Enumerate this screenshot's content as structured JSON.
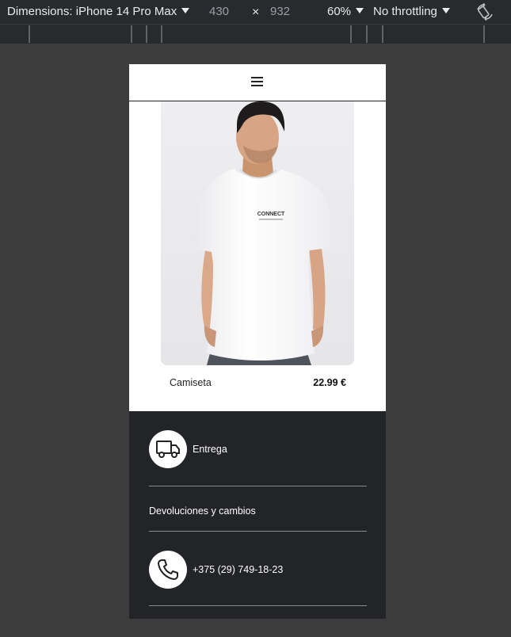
{
  "devtools": {
    "device_label": "Dimensions: iPhone 14 Pro Max",
    "width": "430",
    "times": "×",
    "height": "932",
    "zoom": "60%",
    "throttling": "No throttling"
  },
  "product": {
    "name": "Camiseta",
    "price": "22.99 €",
    "tshirt_brand": "CONNECT"
  },
  "footer": {
    "delivery_label": "Entrega",
    "returns_label": "Devoluciones y cambios",
    "phone_label": "+375 (29) 749-18-23"
  },
  "icons": [
    "menu-icon",
    "truck-icon",
    "phone-icon",
    "rotate-icon"
  ],
  "colors": {
    "footer_bg": "#232427",
    "devtools_bg": "#292a2d",
    "page_bg": "#3c3c3c"
  }
}
